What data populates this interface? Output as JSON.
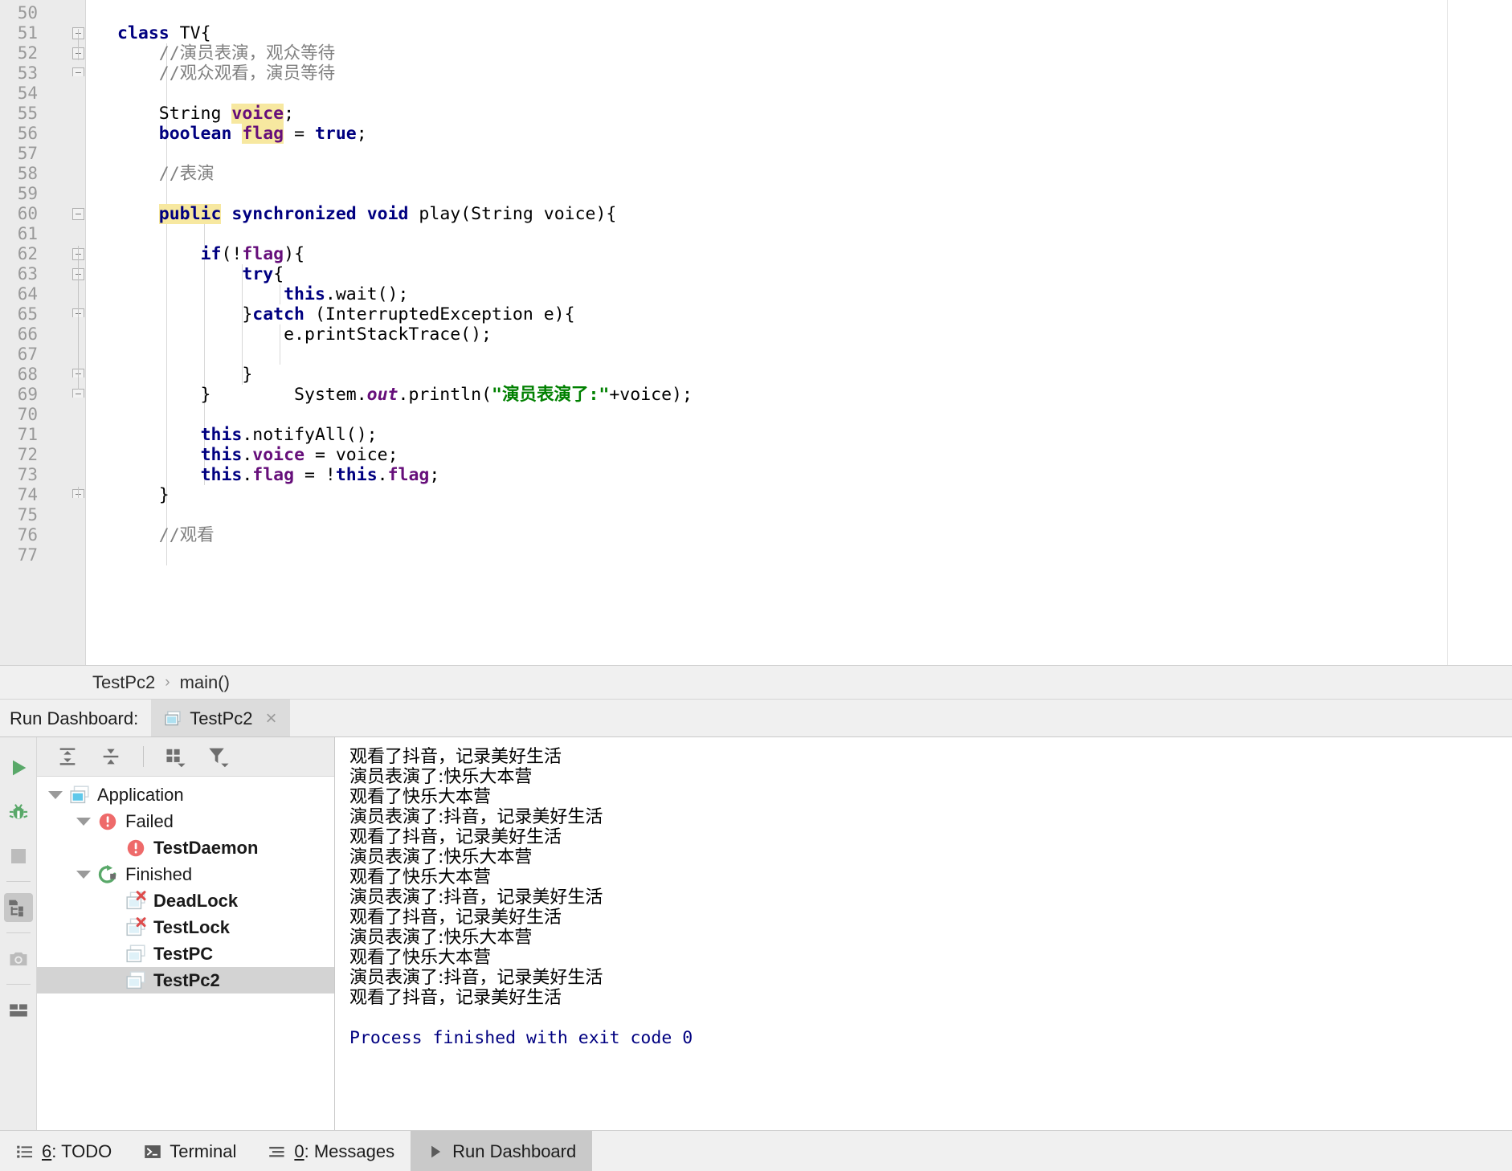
{
  "editor": {
    "first_line": 50,
    "lines": [
      {
        "n": 50,
        "tokens": [],
        "fold": null,
        "indent": []
      },
      {
        "n": 51,
        "tokens": [
          {
            "t": "class",
            "c": "kw"
          },
          {
            "t": " TV{",
            "c": "plain"
          }
        ],
        "fold": "start",
        "indent": []
      },
      {
        "n": 52,
        "tokens": [
          {
            "t": "    //演员表演，观众等待",
            "c": "cmt"
          }
        ],
        "fold": "start",
        "indent": [
          100
        ]
      },
      {
        "n": 53,
        "tokens": [
          {
            "t": "    //观众观看，演员等待",
            "c": "cmt"
          }
        ],
        "fold": "end",
        "indent": [
          100
        ]
      },
      {
        "n": 54,
        "tokens": [],
        "fold": null,
        "indent": [
          100
        ]
      },
      {
        "n": 55,
        "tokens": [
          {
            "t": "    String ",
            "c": "plain"
          },
          {
            "t": "voice",
            "c": "fld hl"
          },
          {
            "t": ";",
            "c": "plain"
          }
        ],
        "fold": null,
        "indent": [
          100
        ]
      },
      {
        "n": 56,
        "tokens": [
          {
            "t": "    ",
            "c": "plain"
          },
          {
            "t": "boolean",
            "c": "kw"
          },
          {
            "t": " ",
            "c": "plain"
          },
          {
            "t": "flag",
            "c": "fld hl"
          },
          {
            "t": " = ",
            "c": "plain"
          },
          {
            "t": "true",
            "c": "kw"
          },
          {
            "t": ";",
            "c": "plain"
          }
        ],
        "fold": null,
        "indent": [
          100
        ]
      },
      {
        "n": 57,
        "tokens": [],
        "fold": null,
        "indent": [
          100
        ]
      },
      {
        "n": 58,
        "tokens": [
          {
            "t": "    //表演",
            "c": "cmt"
          }
        ],
        "fold": null,
        "indent": [
          100
        ]
      },
      {
        "n": 59,
        "tokens": [],
        "fold": null,
        "indent": [
          100
        ]
      },
      {
        "n": 60,
        "tokens": [
          {
            "t": "    ",
            "c": "plain"
          },
          {
            "t": "public",
            "c": "kw hl"
          },
          {
            "t": " ",
            "c": "plain"
          },
          {
            "t": "synchronized",
            "c": "kw"
          },
          {
            "t": " ",
            "c": "plain"
          },
          {
            "t": "void",
            "c": "kw"
          },
          {
            "t": " play(String voice){",
            "c": "plain"
          }
        ],
        "fold": "start",
        "indent": [
          100
        ]
      },
      {
        "n": 61,
        "tokens": [],
        "fold": null,
        "indent": [
          100,
          147
        ]
      },
      {
        "n": 62,
        "tokens": [
          {
            "t": "        ",
            "c": "plain"
          },
          {
            "t": "if",
            "c": "kw"
          },
          {
            "t": "(!",
            "c": "plain"
          },
          {
            "t": "flag",
            "c": "fld"
          },
          {
            "t": "){",
            "c": "plain"
          }
        ],
        "fold": "start",
        "indent": [
          100,
          147
        ]
      },
      {
        "n": 63,
        "tokens": [
          {
            "t": "            ",
            "c": "plain"
          },
          {
            "t": "try",
            "c": "kw"
          },
          {
            "t": "{",
            "c": "plain"
          }
        ],
        "fold": "start",
        "indent": [
          100,
          147,
          194
        ]
      },
      {
        "n": 64,
        "tokens": [
          {
            "t": "                ",
            "c": "plain"
          },
          {
            "t": "this",
            "c": "kw"
          },
          {
            "t": ".wait();",
            "c": "plain"
          }
        ],
        "fold": null,
        "indent": [
          100,
          147,
          194,
          241
        ]
      },
      {
        "n": 65,
        "tokens": [
          {
            "t": "            }",
            "c": "plain"
          },
          {
            "t": "catch",
            "c": "kw"
          },
          {
            "t": " (InterruptedException e){",
            "c": "plain"
          }
        ],
        "fold": "end",
        "indent": [
          100,
          147,
          194
        ]
      },
      {
        "n": 66,
        "tokens": [
          {
            "t": "                e.printStackTrace();",
            "c": "plain"
          }
        ],
        "fold": null,
        "indent": [
          100,
          147,
          194,
          241
        ]
      },
      {
        "n": 67,
        "tokens": [],
        "fold": null,
        "indent": [
          100,
          147,
          194,
          241
        ]
      },
      {
        "n": 68,
        "tokens": [
          {
            "t": "            }",
            "c": "plain"
          }
        ],
        "fold": "end",
        "indent": [
          100,
          147,
          194
        ]
      },
      {
        "n": 69,
        "tokens": [
          {
            "t": "        }        System.",
            "c": "plain"
          },
          {
            "t": "out",
            "c": "stat"
          },
          {
            "t": ".println(",
            "c": "plain"
          },
          {
            "t": "\"演员表演了:\"",
            "c": "str"
          },
          {
            "t": "+voice);",
            "c": "plain"
          }
        ],
        "fold": "end",
        "indent": [
          100,
          147
        ]
      },
      {
        "n": 70,
        "tokens": [],
        "fold": null,
        "indent": [
          100,
          147
        ]
      },
      {
        "n": 71,
        "tokens": [
          {
            "t": "        ",
            "c": "plain"
          },
          {
            "t": "this",
            "c": "kw"
          },
          {
            "t": ".notifyAll();",
            "c": "plain"
          }
        ],
        "fold": null,
        "indent": [
          100,
          147
        ]
      },
      {
        "n": 72,
        "tokens": [
          {
            "t": "        ",
            "c": "plain"
          },
          {
            "t": "this",
            "c": "kw"
          },
          {
            "t": ".",
            "c": "plain"
          },
          {
            "t": "voice",
            "c": "fld"
          },
          {
            "t": " = voice;",
            "c": "plain"
          }
        ],
        "fold": null,
        "indent": [
          100,
          147
        ]
      },
      {
        "n": 73,
        "tokens": [
          {
            "t": "        ",
            "c": "plain"
          },
          {
            "t": "this",
            "c": "kw"
          },
          {
            "t": ".",
            "c": "plain"
          },
          {
            "t": "flag",
            "c": "fld"
          },
          {
            "t": " = !",
            "c": "plain"
          },
          {
            "t": "this",
            "c": "kw"
          },
          {
            "t": ".",
            "c": "plain"
          },
          {
            "t": "flag",
            "c": "fld"
          },
          {
            "t": ";",
            "c": "plain"
          }
        ],
        "fold": null,
        "indent": [
          100,
          147
        ]
      },
      {
        "n": 74,
        "tokens": [
          {
            "t": "    }",
            "c": "plain"
          }
        ],
        "fold": "end",
        "indent": [
          100
        ]
      },
      {
        "n": 75,
        "tokens": [],
        "fold": null,
        "indent": [
          100
        ]
      },
      {
        "n": 76,
        "tokens": [
          {
            "t": "    //观看",
            "c": "cmt"
          }
        ],
        "fold": null,
        "indent": [
          100
        ]
      },
      {
        "n": 77,
        "tokens": [],
        "fold": null,
        "indent": [
          100
        ]
      }
    ]
  },
  "breadcrumb": {
    "items": [
      "TestPc2",
      "main()"
    ],
    "separator": "›"
  },
  "run_dashboard_header": {
    "label": "Run Dashboard:",
    "tab_title": "TestPc2",
    "tab_close": "×"
  },
  "left_rail": {
    "buttons": [
      {
        "name": "rerun-button",
        "icon": "play-icon"
      },
      {
        "name": "debug-button",
        "icon": "bug-icon"
      },
      {
        "name": "stop-button",
        "icon": "stop-icon"
      },
      {
        "name": "show-structure-button",
        "icon": "tree-structure-icon",
        "active": true
      },
      {
        "name": "screenshot-button",
        "icon": "camera-icon"
      },
      {
        "name": "layout-button",
        "icon": "layout-icon"
      }
    ]
  },
  "tree_toolbar": {
    "buttons": [
      {
        "name": "expand-all-button",
        "icon": "expand-all-icon"
      },
      {
        "name": "collapse-all-button",
        "icon": "collapse-all-icon"
      },
      {
        "name": "group-by-button",
        "icon": "group-by-icon"
      },
      {
        "name": "filter-button",
        "icon": "filter-icon"
      }
    ]
  },
  "tree": {
    "nodes": [
      {
        "label": "Application",
        "depth": 0,
        "expanded": true,
        "icon": "application-icon",
        "bold": false,
        "selected": false
      },
      {
        "label": "Failed",
        "depth": 1,
        "expanded": true,
        "icon": "error-icon",
        "bold": false,
        "selected": false
      },
      {
        "label": "TestDaemon",
        "depth": 2,
        "expanded": null,
        "icon": "error-icon",
        "bold": true,
        "selected": false
      },
      {
        "label": "Finished",
        "depth": 1,
        "expanded": true,
        "icon": "rerun-icon",
        "bold": false,
        "selected": false
      },
      {
        "label": "DeadLock",
        "depth": 2,
        "expanded": null,
        "icon": "config-error-icon",
        "bold": true,
        "selected": false
      },
      {
        "label": "TestLock",
        "depth": 2,
        "expanded": null,
        "icon": "config-error-icon",
        "bold": true,
        "selected": false
      },
      {
        "label": "TestPC",
        "depth": 2,
        "expanded": null,
        "icon": "config-icon",
        "bold": true,
        "selected": false
      },
      {
        "label": "TestPc2",
        "depth": 2,
        "expanded": null,
        "icon": "config-icon",
        "bold": true,
        "selected": true
      }
    ]
  },
  "console": {
    "lines": [
      {
        "text": "观看了抖音，记录美好生活",
        "style": "normal"
      },
      {
        "text": "演员表演了:快乐大本营",
        "style": "normal"
      },
      {
        "text": "观看了快乐大本营",
        "style": "normal"
      },
      {
        "text": "演员表演了:抖音，记录美好生活",
        "style": "normal"
      },
      {
        "text": "观看了抖音，记录美好生活",
        "style": "normal"
      },
      {
        "text": "演员表演了:快乐大本营",
        "style": "normal"
      },
      {
        "text": "观看了快乐大本营",
        "style": "normal"
      },
      {
        "text": "演员表演了:抖音，记录美好生活",
        "style": "normal"
      },
      {
        "text": "观看了抖音，记录美好生活",
        "style": "normal"
      },
      {
        "text": "演员表演了:快乐大本营",
        "style": "normal"
      },
      {
        "text": "观看了快乐大本营",
        "style": "normal"
      },
      {
        "text": "演员表演了:抖音，记录美好生活",
        "style": "normal"
      },
      {
        "text": "观看了抖音，记录美好生活",
        "style": "normal"
      },
      {
        "text": "",
        "style": "blank"
      },
      {
        "text": "Process finished with exit code 0",
        "style": "exit"
      }
    ]
  },
  "status_bar": {
    "items": [
      {
        "name": "todo-tool-button",
        "mnemonic": "6",
        "label": ": TODO",
        "icon": "list-icon",
        "active": false
      },
      {
        "name": "terminal-tool-button",
        "mnemonic": "",
        "label": "Terminal",
        "icon": "terminal-icon",
        "active": false
      },
      {
        "name": "messages-tool-button",
        "mnemonic": "0",
        "label": ": Messages",
        "icon": "messages-icon",
        "active": false
      },
      {
        "name": "run-dashboard-tool-button",
        "mnemonic": "",
        "label": "Run Dashboard",
        "icon": "play-small-icon",
        "active": true
      }
    ]
  },
  "colors": {
    "keyword": "#000080",
    "field": "#660e7a",
    "comment": "#808080",
    "string": "#008000",
    "highlight": "#f7e8a0",
    "error_red": "#ee6a6a",
    "success_green": "#59a869",
    "console_exit": "#000080",
    "selection": "#d3d3d3"
  }
}
